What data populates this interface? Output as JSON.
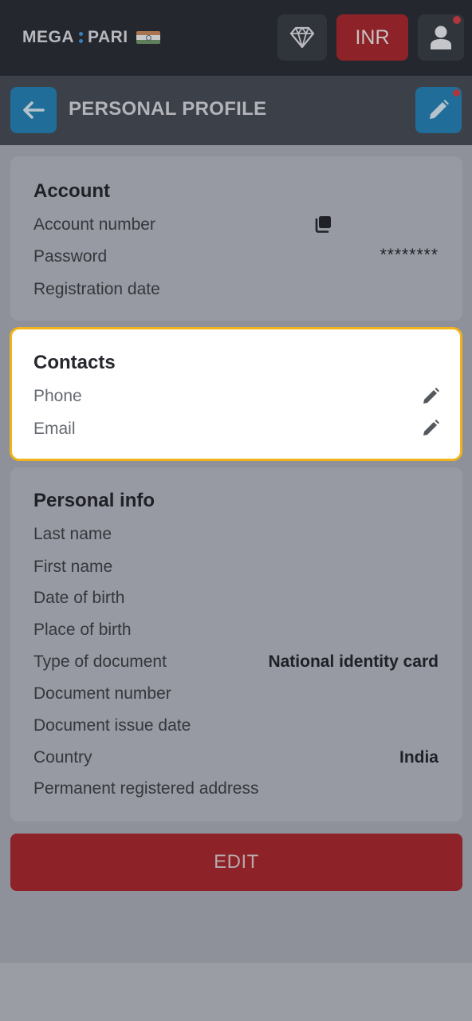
{
  "header": {
    "logo_left": "MEGA",
    "logo_right": "PARI",
    "currency_label": "INR",
    "icons": [
      "diamond-icon",
      "user-icon",
      "india-flag-icon"
    ]
  },
  "titlebar": {
    "title": "PERSONAL PROFILE",
    "icons": [
      "arrow-left-icon",
      "pencil-icon"
    ]
  },
  "account": {
    "heading": "Account",
    "rows": [
      {
        "label": "Account number",
        "value": ""
      },
      {
        "label": "Password",
        "value": "********"
      },
      {
        "label": "Registration date",
        "value": ""
      }
    ]
  },
  "contacts": {
    "heading": "Contacts",
    "rows": [
      {
        "label": "Phone"
      },
      {
        "label": "Email"
      }
    ]
  },
  "personal": {
    "heading": "Personal info",
    "rows": [
      {
        "label": "Last name",
        "value": ""
      },
      {
        "label": "First name",
        "value": ""
      },
      {
        "label": "Date of birth",
        "value": ""
      },
      {
        "label": "Place of birth",
        "value": ""
      },
      {
        "label": "Type of document",
        "value": "National identity card"
      },
      {
        "label": "Document number",
        "value": ""
      },
      {
        "label": "Document issue date",
        "value": ""
      },
      {
        "label": "Country",
        "value": "India"
      },
      {
        "label": "Permanent registered address",
        "value": ""
      }
    ]
  },
  "edit_button_label": "EDIT",
  "colors": {
    "brand_red": "#8d2228",
    "brand_blue": "#1f6d98",
    "highlight": "#f2b31a"
  }
}
